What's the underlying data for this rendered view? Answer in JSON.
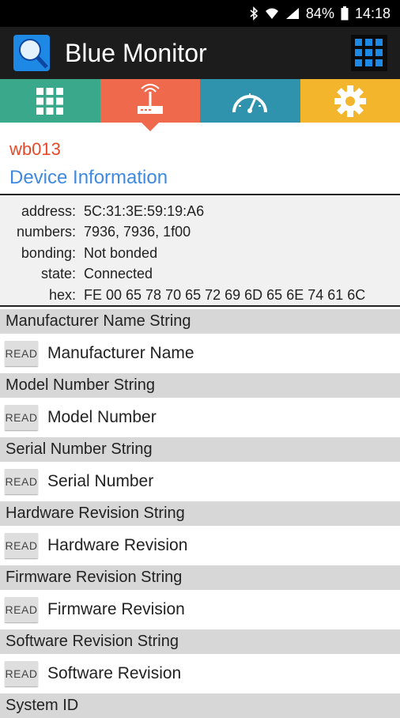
{
  "status_bar": {
    "battery": "84%",
    "time": "14:18",
    "icons": [
      "bluetooth-icon",
      "wifi-icon",
      "signal-icon",
      "battery-icon"
    ]
  },
  "app_bar": {
    "title": "Blue Monitor",
    "logo_icon": "app-logo-icon",
    "menu_icon": "grid-menu-icon"
  },
  "tabs": [
    {
      "icon": "grid-icon",
      "color": "#3aa88b"
    },
    {
      "icon": "router-icon",
      "color": "#ef6a4d",
      "selected": true
    },
    {
      "icon": "speedometer-icon",
      "color": "#2f93ad"
    },
    {
      "icon": "gear-icon",
      "color": "#f2b52c"
    }
  ],
  "device": {
    "name": "wb013",
    "section_title": "Device Information"
  },
  "info": [
    {
      "key": "address:",
      "value": "5C:31:3E:59:19:A6"
    },
    {
      "key": "numbers:",
      "value": "7936, 7936, 1f00"
    },
    {
      "key": "bonding:",
      "value": "Not bonded"
    },
    {
      "key": "state:",
      "value": "Connected"
    },
    {
      "key": "hex:",
      "value": "FE 00 65 78 70 65 72 69 6D 65 6E 74 61 6C"
    }
  ],
  "characteristics": [
    {
      "header": "Manufacturer Name String",
      "button": "READ",
      "name": "Manufacturer Name"
    },
    {
      "header": "Model Number String",
      "button": "READ",
      "name": "Model Number"
    },
    {
      "header": "Serial Number String",
      "button": "READ",
      "name": "Serial Number"
    },
    {
      "header": "Hardware Revision String",
      "button": "READ",
      "name": "Hardware Revision"
    },
    {
      "header": "Firmware Revision String",
      "button": "READ",
      "name": "Firmware Revision"
    },
    {
      "header": "Software Revision String",
      "button": "READ",
      "name": "Software Revision"
    },
    {
      "header": "System ID"
    }
  ]
}
